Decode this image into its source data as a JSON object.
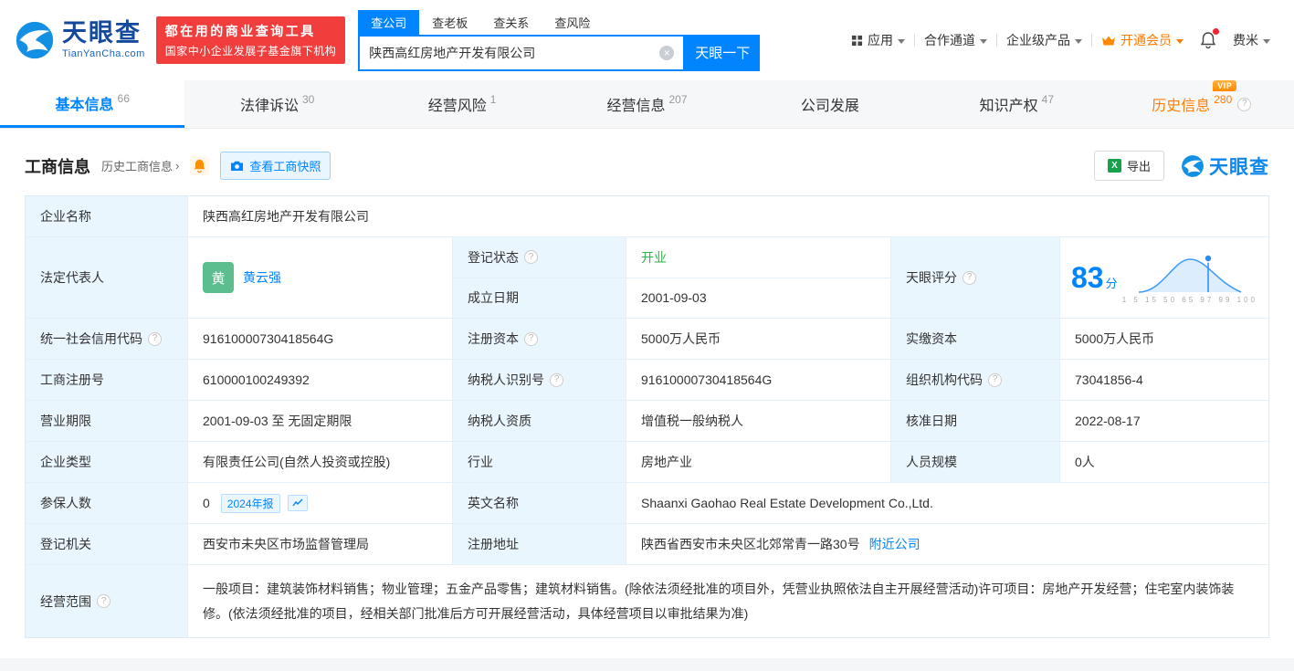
{
  "colors": {
    "accent_blue": "#0084ff",
    "brand_navy": "#15499b",
    "vip_orange": "#ff8000",
    "status_green": "#2bb24c",
    "slogan_red": "#f23d3d",
    "avatar_green": "#5cbd8e",
    "excel_green": "#15a24a",
    "label_bg": "#e9f6fe"
  },
  "icons": {
    "help": "?",
    "arrow": "›",
    "clear": "×",
    "vip": "VIP",
    "excel": "X"
  },
  "header": {
    "brand": "天眼查",
    "brand_domain": "TianYanCha.com",
    "slogan_line1": "都在用的商业查询工具",
    "slogan_line2": "国家中小企业发展子基金旗下机构",
    "search_tabs": [
      "查公司",
      "查老板",
      "查关系",
      "查风险"
    ],
    "search_value": "陕西高红房地产开发有限公司",
    "search_button": "天眼一下",
    "nav_app": "应用",
    "nav_coop": "合作通道",
    "nav_enterprise": "企业级产品",
    "nav_vip": "开通会员",
    "nav_user": "费米"
  },
  "tabs": [
    {
      "label": "基本信息",
      "count": "66"
    },
    {
      "label": "法律诉讼",
      "count": "30"
    },
    {
      "label": "经营风险",
      "count": "1"
    },
    {
      "label": "经营信息",
      "count": "207"
    },
    {
      "label": "公司发展",
      "count": ""
    },
    {
      "label": "知识产权",
      "count": "47"
    },
    {
      "label": "历史信息",
      "count": "280"
    }
  ],
  "section": {
    "title": "工商信息",
    "history_link": "历史工商信息",
    "snapshot_button": "查看工商快照",
    "export_button": "导出",
    "brand_watermark": "天眼查"
  },
  "info": {
    "company_name_label": "企业名称",
    "company_name": "陕西高红房地产开发有限公司",
    "legal_rep_label": "法定代表人",
    "legal_rep_avatar": "黄",
    "legal_rep_name": "黄云强",
    "reg_status_label": "登记状态",
    "reg_status": "开业",
    "establish_date_label": "成立日期",
    "establish_date": "2001-09-03",
    "score_label": "天眼评分",
    "score_value": "83",
    "score_unit": "分",
    "score_axis": "1 5 15 50 65 97 99 100",
    "credit_code_label": "统一社会信用代码",
    "credit_code": "91610000730418564G",
    "reg_capital_label": "注册资本",
    "reg_capital": "5000万人民币",
    "paid_capital_label": "实缴资本",
    "paid_capital": "5000万人民币",
    "reg_number_label": "工商注册号",
    "reg_number": "610000100249392",
    "taxpayer_id_label": "纳税人识别号",
    "taxpayer_id": "91610000730418564G",
    "org_code_label": "组织机构代码",
    "org_code": "73041856-4",
    "business_term_label": "营业期限",
    "business_term": "2001-09-03 至 无固定期限",
    "taxpayer_quality_label": "纳税人资质",
    "taxpayer_quality": "增值税一般纳税人",
    "approval_date_label": "核准日期",
    "approval_date": "2022-08-17",
    "company_type_label": "企业类型",
    "company_type": "有限责任公司(自然人投资或控股)",
    "industry_label": "行业",
    "industry": "房地产业",
    "staff_size_label": "人员规模",
    "staff_size": "0人",
    "insured_label": "参保人数",
    "insured_count": "0",
    "annual_report_tag": "2024年报",
    "english_name_label": "英文名称",
    "english_name": "Shaanxi Gaohao Real Estate Development Co.,Ltd.",
    "reg_authority_label": "登记机关",
    "reg_authority": "西安市未央区市场监督管理局",
    "reg_address_label": "注册地址",
    "reg_address": "陕西省西安市未央区北郊常青一路30号",
    "nearby_link": "附近公司",
    "business_scope_label": "经营范围",
    "business_scope": "一般项目：建筑装饰材料销售；物业管理；五金产品零售；建筑材料销售。(除依法须经批准的项目外，凭营业执照依法自主开展经营活动)许可项目：房地产开发经营；住宅室内装饰装修。(依法须经批准的项目，经相关部门批准后方可开展经营活动，具体经营项目以审批结果为准)"
  }
}
